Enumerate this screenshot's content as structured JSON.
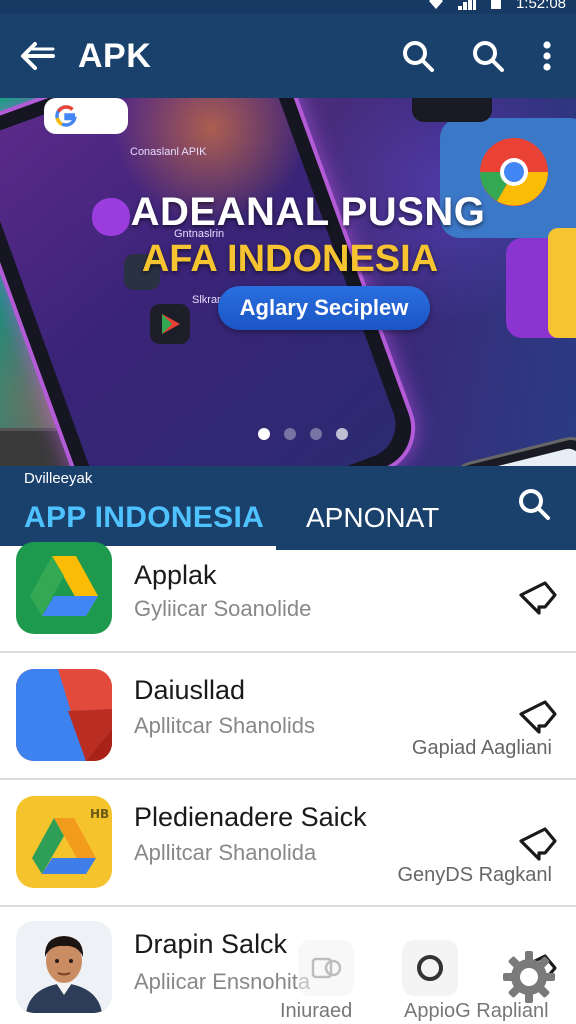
{
  "status_bar": {
    "time": "1:52:08"
  },
  "app_bar": {
    "title": "APK"
  },
  "banner": {
    "headline": "ADEANAL PUSNG",
    "subheadline": "AFA INDONESIA",
    "cta": "Aglary Seciplew",
    "phone_menu": [
      "Conaslanl APIK",
      "Gntnaslrin",
      "Slkranlers"
    ],
    "slides": 4,
    "active_slide": 1
  },
  "tabs": {
    "caption": "Dvilleeyak",
    "items": [
      {
        "label": "APP INDONESIA",
        "active": true
      },
      {
        "label": "APNONAT",
        "active": false
      }
    ]
  },
  "apps": [
    {
      "title": "Applak",
      "subtitle": "Gyliicar Soanolide",
      "extra": ""
    },
    {
      "title": "Daiusllad",
      "subtitle": "Apllitcar Shanolids",
      "extra": "Gapiad Aagliani"
    },
    {
      "title": "Pledienadere Saick",
      "subtitle": "Apllitcar Shanolida",
      "extra": "GenyDS Ragkanl"
    },
    {
      "title": "Drapin Salck",
      "subtitle": "Apliicar Ensnohita",
      "extra": ""
    }
  ],
  "bottom_overlay": {
    "left_label": "Iniuraed",
    "right_label": "AppioG Raplianl"
  },
  "colors": {
    "bar": "#1a416b",
    "accent": "#4fc3ff",
    "cta": "#1b55c4",
    "headline_yellow": "#f5c430"
  }
}
